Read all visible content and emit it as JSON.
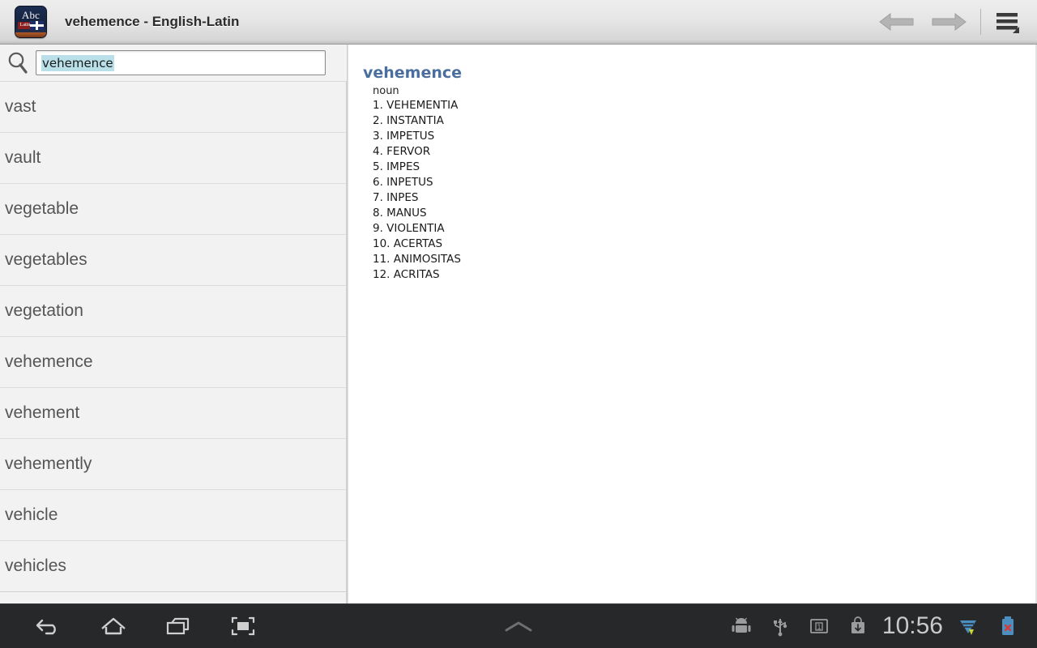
{
  "titlebar": {
    "app_icon_name": "dictionary-book-icon",
    "icon_abc": "Abc",
    "icon_latin": "Latin",
    "title": "vehemence - English-Latin",
    "back_label": "back-arrow",
    "forward_label": "forward-arrow",
    "menu_label": "overflow-menu"
  },
  "search": {
    "value": "vehemence",
    "placeholder": "",
    "icon": "search-icon"
  },
  "wordlist": [
    "vast",
    "vault",
    "vegetable",
    "vegetables",
    "vegetation",
    "vehemence",
    "vehement",
    "vehemently",
    "vehicle",
    "vehicles"
  ],
  "definition": {
    "headword": "vehemence",
    "part_of_speech": "noun",
    "senses": [
      "1. VEHEMENTIA",
      "2. INSTANTIA",
      "3. IMPETUS",
      "4. FERVOR",
      "5. IMPES",
      "6. INPETUS",
      "7. INPES",
      "8. MANUS",
      "9. VIOLENTIA",
      "10. ACERTAS",
      "11. ANIMOSITAS",
      "12. ACRITAS"
    ]
  },
  "systembar": {
    "back": "back-icon",
    "home": "home-icon",
    "recents": "recent-apps-icon",
    "screenshot": "fullscreen-icon",
    "notification_handle": "chevron-up-icon",
    "status_icons": [
      "android-robot-icon",
      "usb-icon",
      "workspace-1-icon",
      "download-icon"
    ],
    "clock": "10:56",
    "wifi": "wifi-icon",
    "battery": "battery-icon"
  },
  "colors": {
    "headword": "#4a6f9e",
    "selection": "#b9dfe9",
    "list_text": "#555555",
    "sysbar": "#26282a",
    "status_text": "#c9c9c9"
  }
}
